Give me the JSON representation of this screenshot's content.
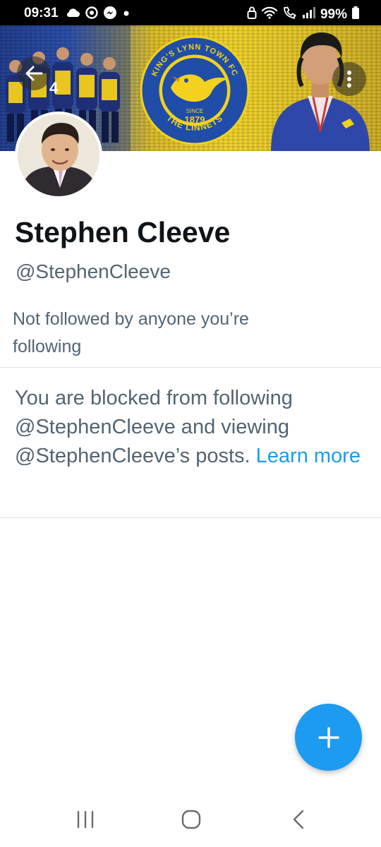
{
  "status_bar": {
    "time": "09:31",
    "battery": "99%",
    "icons_left": [
      "cloud-icon",
      "sync-icon",
      "messenger-icon",
      "dot-icon"
    ],
    "icons_right": [
      "lock-icon",
      "wifi-icon",
      "wifi-calling-icon",
      "signal-icon",
      "battery-icon"
    ]
  },
  "banner": {
    "crest_top_text": "KING'S LYNN TOWN FC",
    "crest_since": "SINCE",
    "crest_year": "1879",
    "crest_bottom_text": "THE LINNETS",
    "player_number": "4"
  },
  "profile": {
    "display_name": "Stephen Cleeve",
    "handle": "@StephenCleeve",
    "follow_note": "Not followed by anyone you’re following",
    "blocked_message": "You are blocked from following @StephenCleeve and viewing @StephenCleeve’s posts.",
    "learn_more": "Learn more"
  },
  "colors": {
    "accent": "#1d9bf0",
    "primary_text": "#0f1419",
    "secondary_text": "#536471",
    "divider": "#dfe3e6"
  },
  "nav": {
    "icons": [
      "recents-icon",
      "home-icon",
      "back-icon"
    ]
  }
}
